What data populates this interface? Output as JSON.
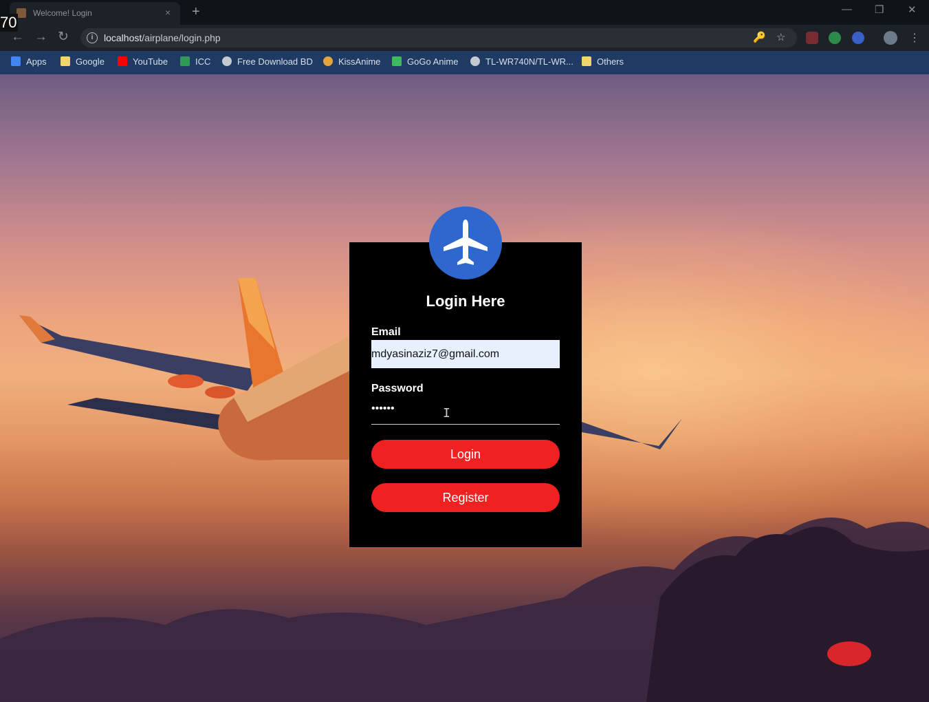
{
  "overlay": {
    "timestamp": "70"
  },
  "browser": {
    "tab_title": "Welcome! Login",
    "tab_close": "×",
    "new_tab": "+",
    "window_controls": {
      "minimize": "—",
      "restore": "❐",
      "close": "✕"
    },
    "nav": {
      "back": "←",
      "forward": "→",
      "reload": "↻"
    },
    "url_host": "localhost",
    "url_path": "/airplane/login.php",
    "key_icon": "🔑",
    "star_icon": "☆",
    "menu": "⋮",
    "bookmarks": [
      {
        "label": "Apps",
        "icon": "apps-grid-icon",
        "color": "#4285f4"
      },
      {
        "label": "Google",
        "icon": "folder-icon",
        "color": "#f3d36b"
      },
      {
        "label": "YouTube",
        "icon": "youtube-icon",
        "color": "#ff0000"
      },
      {
        "label": "ICC",
        "icon": "icc-icon",
        "color": "#2e9a52"
      },
      {
        "label": "Free Download BD",
        "icon": "globe-icon",
        "color": "#c5c9d0"
      },
      {
        "label": "KissAnime",
        "icon": "kissanime-icon",
        "color": "#e6a23c"
      },
      {
        "label": "GoGo Anime",
        "icon": "gogoanime-icon",
        "color": "#3dbb5a"
      },
      {
        "label": "TL-WR740N/TL-WR...",
        "icon": "globe-icon",
        "color": "#c5c9d0"
      },
      {
        "label": "Others",
        "icon": "folder-icon",
        "color": "#f3d36b"
      }
    ]
  },
  "login": {
    "title": "Login Here",
    "email_label": "Email",
    "email_value": "mdyasinaziz7@gmail.com",
    "password_label": "Password",
    "password_value": "••••••",
    "login_button": "Login",
    "register_button": "Register"
  },
  "colors": {
    "card": "#000000",
    "logo": "#2f67cf",
    "button": "#f02121",
    "bookmarks_bar": "#1f3b64"
  }
}
